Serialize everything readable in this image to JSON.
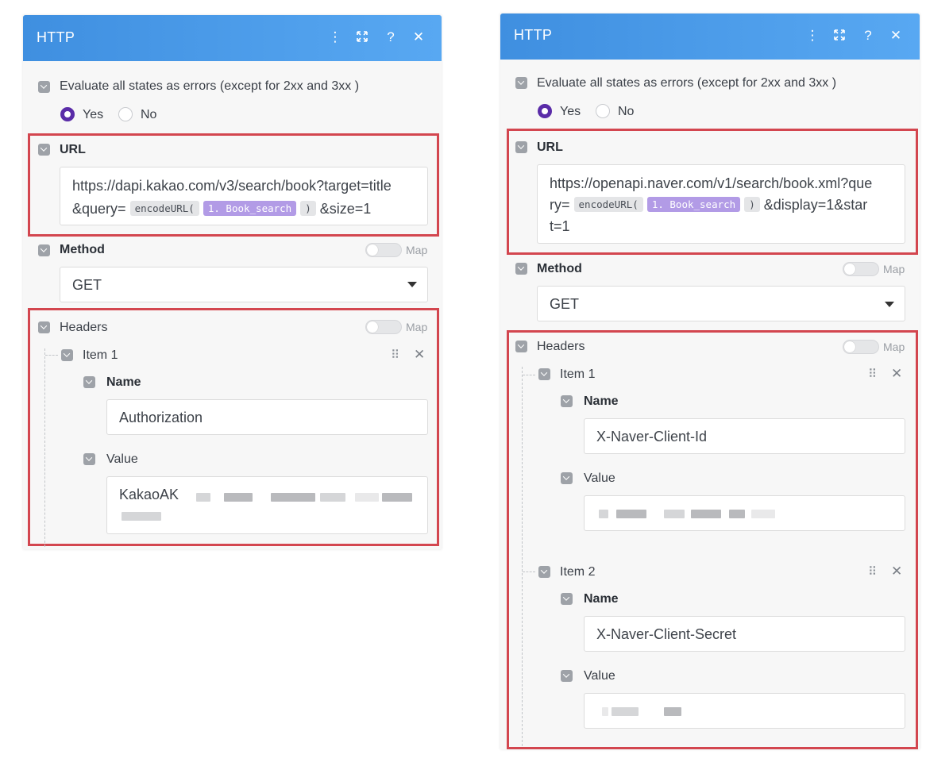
{
  "left": {
    "title": "HTTP",
    "evaluate_label": "Evaluate all states as errors (except for 2xx and 3xx )",
    "yes_label": "Yes",
    "no_label": "No",
    "url_label": "URL",
    "url_line1": "https://dapi.kakao.com/v3/search/book?target=title",
    "url_line2_prefix": "&query=",
    "url_fn": "encodeURL(",
    "url_var": "1. Book_search",
    "url_close": ")",
    "url_suffix": "&size=1",
    "method_label": "Method",
    "map_label": "Map",
    "method_value": "GET",
    "headers_label": "Headers",
    "items": [
      {
        "title": "Item 1",
        "name_label": "Name",
        "name_value": "Authorization",
        "value_label": "Value",
        "value_prefix": "KakaoAK"
      }
    ]
  },
  "right": {
    "title": "HTTP",
    "evaluate_label": "Evaluate all states as errors (except for 2xx and 3xx )",
    "yes_label": "Yes",
    "no_label": "No",
    "url_label": "URL",
    "url_line1": "https://openapi.naver.com/v1/search/book.xml?que",
    "url_line2_prefix": "ry=",
    "url_fn": "encodeURL(",
    "url_var": "1. Book_search",
    "url_close": ")",
    "url_suffix": "&display=1&star",
    "url_line3": "t=1",
    "method_label": "Method",
    "map_label": "Map",
    "method_value": "GET",
    "headers_label": "Headers",
    "items": [
      {
        "title": "Item 1",
        "name_label": "Name",
        "name_value": "X-Naver-Client-Id",
        "value_label": "Value"
      },
      {
        "title": "Item 2",
        "name_label": "Name",
        "name_value": "X-Naver-Client-Secret",
        "value_label": "Value"
      }
    ]
  },
  "icons": [
    "more-vertical-icon",
    "expand-icon",
    "help-icon",
    "close-icon",
    "drag-handle-icon",
    "remove-icon",
    "dropdown-caret-icon"
  ],
  "colors": {
    "header_blue": "#4a9cea",
    "highlight_red": "#d3464f",
    "radio_purple": "#5a2ca8",
    "variable_purple": "#b29be6"
  }
}
